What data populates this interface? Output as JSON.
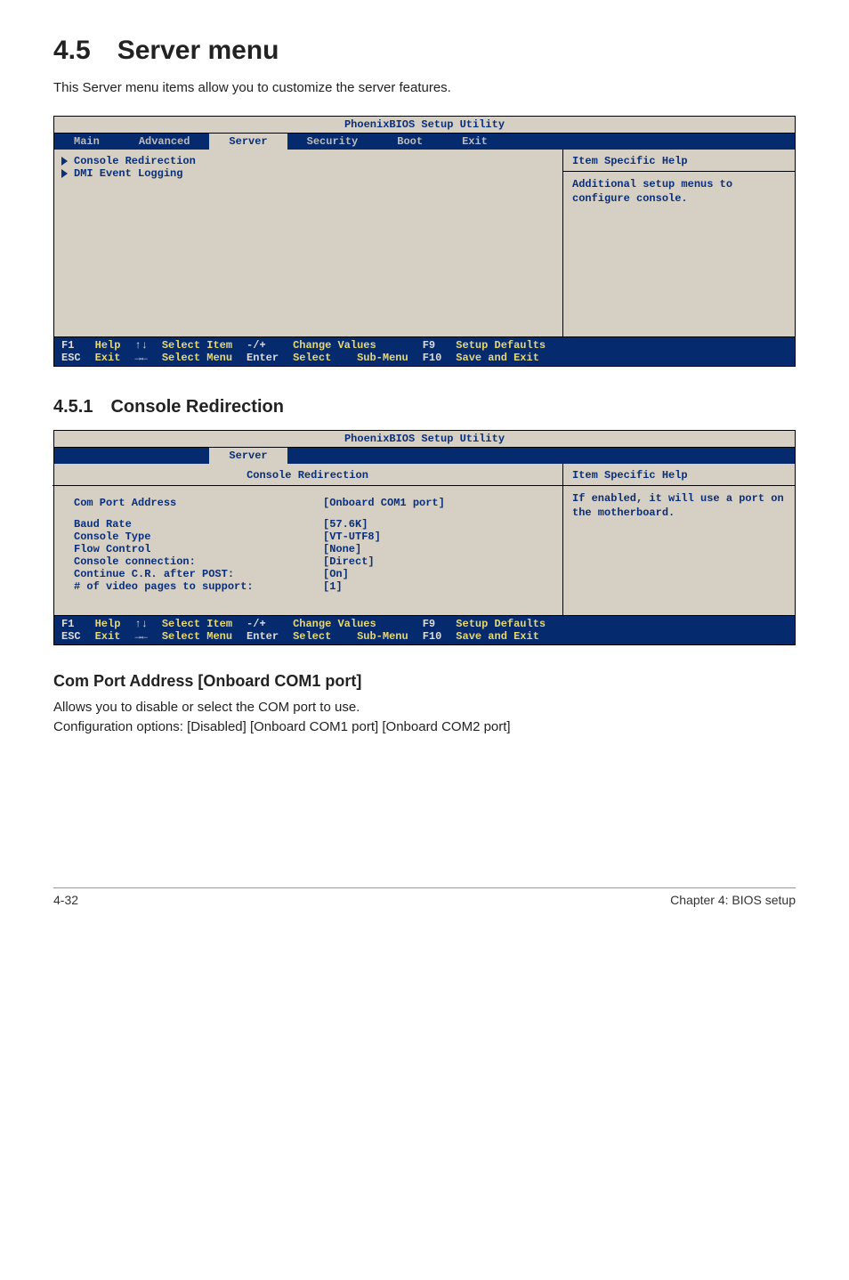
{
  "section_heading": "4.5 Server menu",
  "section_para": "This Server menu items allow you to customize the server features.",
  "bios1": {
    "title": "PhoenixBIOS Setup Utility",
    "tabs": [
      "Main",
      "Advanced",
      "Server",
      "Security",
      "Boot",
      "Exit"
    ],
    "active_tab": "Server",
    "menu": {
      "item1": "Console Redirection",
      "item2": "DMI Event Logging"
    },
    "help_title": "Item Specific Help",
    "help_text": "Additional setup menus to configure console."
  },
  "subsection_heading": "4.5.1 Console Redirection",
  "bios2": {
    "title": "PhoenixBIOS Setup Utility",
    "active_tab": "Server",
    "panel_title": "Console Redirection",
    "rows": {
      "r1": {
        "label": "Com Port Address",
        "value": "[Onboard COM1 port]"
      },
      "r2": {
        "label": "Baud Rate",
        "value": "[57.6K]"
      },
      "r3": {
        "label": "Console Type",
        "value": "[VT-UTF8]"
      },
      "r4": {
        "label": "Flow Control",
        "value": "[None]"
      },
      "r5": {
        "label": "Console connection:",
        "value": "[Direct]"
      },
      "r6": {
        "label": "Continue C.R. after POST:",
        "value": "[On]"
      },
      "r7": {
        "label": "# of video pages to support:",
        "value": "[1]"
      }
    },
    "help_title": "Item Specific Help",
    "help_text": "If enabled, it will use a port on the motherboard."
  },
  "footer_keys": {
    "c1a": "F1",
    "c1b": "ESC",
    "c2a": "Help",
    "c2b": "Exit",
    "c3a": "↑↓",
    "c3b": "→←",
    "c4a": "Select Item",
    "c4b": "Select Menu",
    "c5a": "-/+",
    "c5b": "Enter",
    "c6a": "Change Values",
    "c6b": "Select    Sub-Menu",
    "c7a": "F9",
    "c7b": "F10",
    "c8a": "Setup Defaults",
    "c8b": "Save and Exit"
  },
  "option_heading": "Com Port Address [Onboard COM1 port]",
  "option_para": "Allows you to disable or select the COM port to use.\nConfiguration options: [Disabled] [Onboard COM1 port] [Onboard COM2 port]",
  "page_footer_left": "4-32",
  "page_footer_right": "Chapter 4: BIOS setup"
}
